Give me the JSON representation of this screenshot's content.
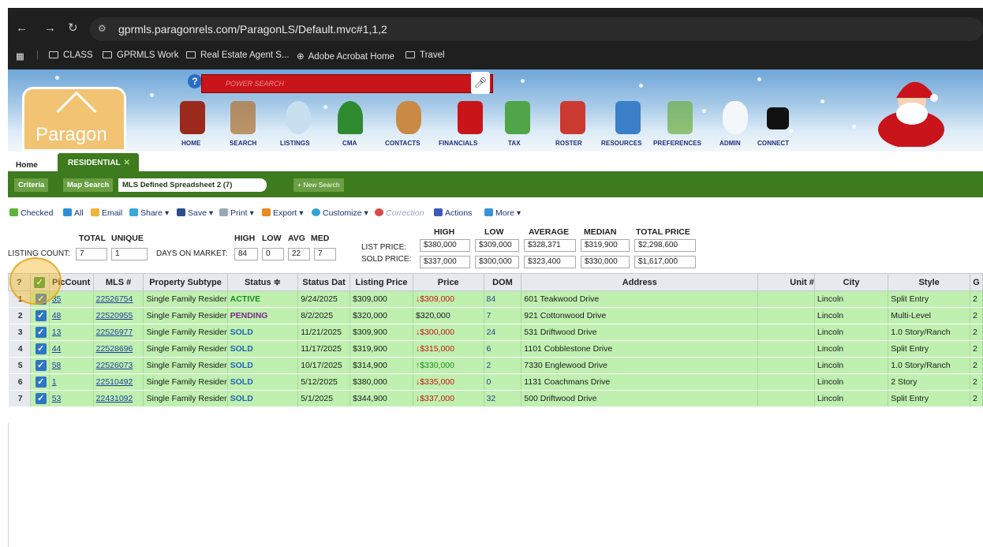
{
  "browser": {
    "url": "gprmls.paragonrels.com/ParagonLS/Default.mvc#1,1,2",
    "bookmarks": [
      "CLASS",
      "GPRMLS Work",
      "Real Estate Agent S...",
      "Adobe Acrobat Home",
      "Travel"
    ]
  },
  "app": {
    "logo_text": "Paragon",
    "search_placeholder": "POWER SEARCH",
    "nav": [
      "HOME",
      "SEARCH",
      "LISTINGS",
      "CMA",
      "CONTACTS",
      "FINANCIALS",
      "TAX",
      "ROSTER",
      "RESOURCES",
      "PREFERENCES",
      "ADMIN",
      "CONNECT"
    ]
  },
  "tabs": {
    "home": "Home",
    "residential": "RESIDENTIAL"
  },
  "subtabs": {
    "criteria": "Criteria",
    "map_search": "Map Search",
    "spreadsheet": "MLS Defined Spreadsheet 2 (7)",
    "new_search": "+ New Search"
  },
  "toolbar": [
    "Checked",
    "All",
    "Email",
    "Share",
    "Save",
    "Print",
    "Export",
    "Customize",
    "Correction",
    "Actions",
    "More"
  ],
  "stats": {
    "total_label": "TOTAL",
    "unique_label": "UNIQUE",
    "listing_count_label": "LISTING COUNT:",
    "listing_total": "7",
    "listing_unique": "1",
    "dom_label": "DAYS ON MARKET:",
    "dom_headers": [
      "HIGH",
      "LOW",
      "AVG",
      "MED"
    ],
    "dom_values": [
      "84",
      "0",
      "22",
      "7"
    ],
    "price_headers": [
      "HIGH",
      "LOW",
      "AVERAGE",
      "MEDIAN",
      "TOTAL PRICE"
    ],
    "list_price_label": "LIST PRICE:",
    "list_price": [
      "$380,000",
      "$309,000",
      "$328,371",
      "$319,900",
      "$2,298,600"
    ],
    "sold_price_label": "SOLD PRICE:",
    "sold_price": [
      "$337,000",
      "$300,000",
      "$323,400",
      "$330,000",
      "$1,617,000"
    ]
  },
  "grid": {
    "columns": [
      "?",
      "✓",
      "PicCount",
      "MLS #",
      "Property Subtype",
      "Status ≑",
      "Status Dat",
      "Listing Price",
      "Price",
      "DOM",
      "Address",
      "Unit #",
      "City",
      "Style",
      "G"
    ],
    "rows": [
      {
        "n": "1",
        "pic": "35",
        "mls": "22526754",
        "subtype": "Single Family Resider",
        "status": "ACTIVE",
        "sclass": "active",
        "date": "9/24/2025",
        "list": "$309,000",
        "arrow": "↓",
        "pclass": "down",
        "price": "$309,000",
        "dom": "84",
        "addr": "601 Teakwood Drive",
        "unit": "",
        "city": "Lincoln",
        "style": "Split Entry",
        "g": "2"
      },
      {
        "n": "2",
        "pic": "48",
        "mls": "22520955",
        "subtype": "Single Family Resider",
        "status": "PENDING",
        "sclass": "pending",
        "date": "8/2/2025",
        "list": "$320,000",
        "arrow": "",
        "pclass": "",
        "price": "$320,000",
        "dom": "7",
        "addr": "921 Cottonwood Drive",
        "unit": "",
        "city": "Lincoln",
        "style": "Multi-Level",
        "g": "2"
      },
      {
        "n": "3",
        "pic": "13",
        "mls": "22526977",
        "subtype": "Single Family Resider",
        "status": "SOLD",
        "sclass": "sold",
        "date": "11/21/2025",
        "list": "$309,900",
        "arrow": "↓",
        "pclass": "down",
        "price": "$300,000",
        "dom": "24",
        "addr": "531 Driftwood Drive",
        "unit": "",
        "city": "Lincoln",
        "style": "1.0 Story/Ranch",
        "g": "2"
      },
      {
        "n": "4",
        "pic": "44",
        "mls": "22528696",
        "subtype": "Single Family Resider",
        "status": "SOLD",
        "sclass": "sold",
        "date": "11/17/2025",
        "list": "$319,900",
        "arrow": "↓",
        "pclass": "down",
        "price": "$315,000",
        "dom": "6",
        "addr": "1101 Cobblestone Drive",
        "unit": "",
        "city": "Lincoln",
        "style": "Split Entry",
        "g": "2"
      },
      {
        "n": "5",
        "pic": "58",
        "mls": "22526073",
        "subtype": "Single Family Resider",
        "status": "SOLD",
        "sclass": "sold",
        "date": "10/17/2025",
        "list": "$314,900",
        "arrow": "↑",
        "pclass": "up",
        "price": "$330,000",
        "dom": "2",
        "addr": "7330 Englewood Drive",
        "unit": "",
        "city": "Lincoln",
        "style": "1.0 Story/Ranch",
        "g": "2"
      },
      {
        "n": "6",
        "pic": "1",
        "mls": "22510492",
        "subtype": "Single Family Resider",
        "status": "SOLD",
        "sclass": "sold",
        "date": "5/12/2025",
        "list": "$380,000",
        "arrow": "↓",
        "pclass": "down",
        "price": "$335,000",
        "dom": "0",
        "addr": "1131 Coachmans Drive",
        "unit": "",
        "city": "Lincoln",
        "style": "2 Story",
        "g": "2"
      },
      {
        "n": "7",
        "pic": "53",
        "mls": "22431092",
        "subtype": "Single Family Resider",
        "status": "SOLD",
        "sclass": "sold",
        "date": "5/1/2025",
        "list": "$344,900",
        "arrow": "↓",
        "pclass": "down",
        "price": "$337,000",
        "dom": "32",
        "addr": "500 Driftwood Drive",
        "unit": "",
        "city": "Lincoln",
        "style": "Split Entry",
        "g": "2"
      }
    ]
  }
}
